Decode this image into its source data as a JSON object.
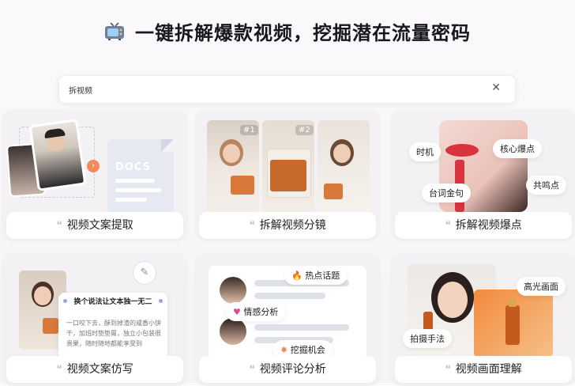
{
  "header": {
    "title": "一键拆解爆款视频，挖掘潜在流量密码",
    "icon": "tv-icon"
  },
  "search": {
    "value": "拆视频",
    "clear_icon": "close-icon"
  },
  "cards": [
    {
      "label": "视频文案提取",
      "doc_text": "DOCS"
    },
    {
      "label": "拆解视频分镜",
      "badges": [
        "#1",
        "#2"
      ]
    },
    {
      "label": "拆解视频爆点",
      "tags": [
        "时机",
        "核心爆点",
        "共鸣点",
        "台词金句"
      ]
    },
    {
      "label": "视频文案仿写",
      "bubble_title": "换个说法让文本独一无二",
      "bubble_body": "一口咬下去，酥到掉渣的咸香小饼干，加班时垫垫胃，独立小包装很贵果，随时随地都能享受到"
    },
    {
      "label": "视频评论分析",
      "tags": [
        "热点话题",
        "情感分析",
        "挖掘机会"
      ]
    },
    {
      "label": "视频画面理解",
      "tags": [
        "高光画面",
        "拍摄手法"
      ]
    }
  ],
  "colors": {
    "accent": "#f28a5c",
    "card_bg": "#f4f1f4",
    "lipstick": "#d8333f"
  }
}
